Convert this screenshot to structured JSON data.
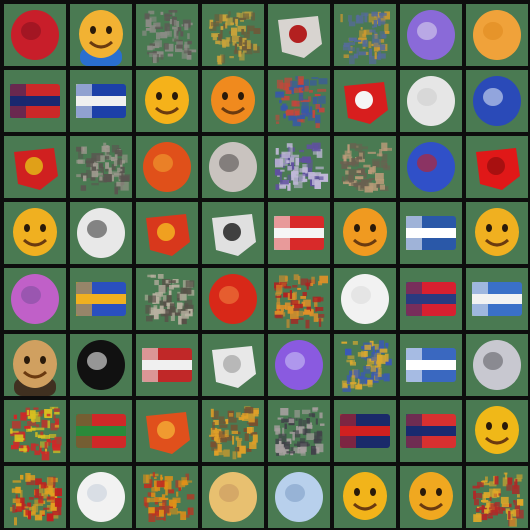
{
  "background_color": "#4a7a52",
  "grid": {
    "rows": 8,
    "cols": 8
  },
  "tiles": [
    {
      "kind": "blob",
      "main": "#c81e2a",
      "accent": "#8a1020"
    },
    {
      "kind": "face-person",
      "main": "#f2b233",
      "accent": "#2a6fd0"
    },
    {
      "kind": "noise",
      "main": "#8c8c86",
      "accent": "#5d5a55"
    },
    {
      "kind": "noise",
      "main": "#c9a33a",
      "accent": "#6d5b3a"
    },
    {
      "kind": "shape",
      "main": "#d8d4d0",
      "accent": "#b32020"
    },
    {
      "kind": "noise",
      "main": "#d09a2e",
      "accent": "#556b9a"
    },
    {
      "kind": "blob",
      "main": "#8a6ad8",
      "accent": "#d8d2ef"
    },
    {
      "kind": "blob",
      "main": "#f0a23a",
      "accent": "#e08a20"
    },
    {
      "kind": "flag",
      "main": "#cc2828",
      "accent": "#1a2870"
    },
    {
      "kind": "flag",
      "main": "#1c40a8",
      "accent": "#f0f0f0"
    },
    {
      "kind": "face",
      "main": "#f5b21a",
      "accent": "#3a2a10"
    },
    {
      "kind": "face",
      "main": "#f08a1e",
      "accent": "#2a6a5a"
    },
    {
      "kind": "noise",
      "main": "#c8453a",
      "accent": "#3858a8"
    },
    {
      "kind": "shape",
      "main": "#d81e1e",
      "accent": "#f5f5f5"
    },
    {
      "kind": "blob",
      "main": "#e6e6e6",
      "accent": "#cfcfcf"
    },
    {
      "kind": "blob",
      "main": "#2a4ab8",
      "accent": "#d8e2f5"
    },
    {
      "kind": "shape",
      "main": "#d02020",
      "accent": "#e0a018"
    },
    {
      "kind": "noise",
      "main": "#a09a90",
      "accent": "#5a5550"
    },
    {
      "kind": "blob",
      "main": "#e0501a",
      "accent": "#f0a030"
    },
    {
      "kind": "blob",
      "main": "#c9c3bf",
      "accent": "#555050"
    },
    {
      "kind": "noise",
      "main": "#c0b8d8",
      "accent": "#6050a0"
    },
    {
      "kind": "noise",
      "main": "#b89a78",
      "accent": "#6a6050"
    },
    {
      "kind": "blob",
      "main": "#3050c8",
      "accent": "#c82020"
    },
    {
      "kind": "shape",
      "main": "#e01818",
      "accent": "#a81010"
    },
    {
      "kind": "face",
      "main": "#f0b020",
      "accent": "#c85a10"
    },
    {
      "kind": "blob",
      "main": "#e8e8e8",
      "accent": "#404040"
    },
    {
      "kind": "shape",
      "main": "#d8381c",
      "accent": "#f0a020"
    },
    {
      "kind": "shape",
      "main": "#e0e0e0",
      "accent": "#404040"
    },
    {
      "kind": "flag",
      "main": "#d82a2a",
      "accent": "#f5f5f5"
    },
    {
      "kind": "face",
      "main": "#f09a20",
      "accent": "#d85010"
    },
    {
      "kind": "flag",
      "main": "#2a58a8",
      "accent": "#ffffff"
    },
    {
      "kind": "face",
      "main": "#f0b020",
      "accent": "#a86020"
    },
    {
      "kind": "blob",
      "main": "#c060c8",
      "accent": "#8050a0"
    },
    {
      "kind": "flag",
      "main": "#2a50c0",
      "accent": "#f0b020"
    },
    {
      "kind": "noise",
      "main": "#b8b0a0",
      "accent": "#585048"
    },
    {
      "kind": "blob",
      "main": "#d82818",
      "accent": "#f08040"
    },
    {
      "kind": "noise",
      "main": "#e09028",
      "accent": "#b02020"
    },
    {
      "kind": "blob",
      "main": "#f2f2f2",
      "accent": "#dcdcdc"
    },
    {
      "kind": "flag",
      "main": "#d82030",
      "accent": "#2a3a80"
    },
    {
      "kind": "flag",
      "main": "#3a70c8",
      "accent": "#f2f2f2"
    },
    {
      "kind": "face-person",
      "main": "#d0a060",
      "accent": "#403020"
    },
    {
      "kind": "blob",
      "main": "#111111",
      "accent": "#f0f0f0"
    },
    {
      "kind": "flag",
      "main": "#c02828",
      "accent": "#f0f0f0"
    },
    {
      "kind": "shape",
      "main": "#e8e8e8",
      "accent": "#b8b8b8"
    },
    {
      "kind": "blob",
      "main": "#8a5ae0",
      "accent": "#c8c0f5"
    },
    {
      "kind": "noise",
      "main": "#3a58b8",
      "accent": "#d8a830"
    },
    {
      "kind": "flag",
      "main": "#3a68c0",
      "accent": "#ffffff"
    },
    {
      "kind": "blob",
      "main": "#c8c8d0",
      "accent": "#606068"
    },
    {
      "kind": "noise",
      "main": "#d02828",
      "accent": "#d8c020"
    },
    {
      "kind": "flag",
      "main": "#d02828",
      "accent": "#2a8a3a"
    },
    {
      "kind": "shape",
      "main": "#e0501c",
      "accent": "#f09a30"
    },
    {
      "kind": "noise",
      "main": "#e0a028",
      "accent": "#7a5030"
    },
    {
      "kind": "noise",
      "main": "#a8a0a0",
      "accent": "#404048"
    },
    {
      "kind": "flag",
      "main": "#1a2a6a",
      "accent": "#d02020"
    },
    {
      "kind": "flag",
      "main": "#d83030",
      "accent": "#1a2a70"
    },
    {
      "kind": "face",
      "main": "#f0b818",
      "accent": "#2a5a48"
    },
    {
      "kind": "noise",
      "main": "#e0a020",
      "accent": "#c02020"
    },
    {
      "kind": "blob",
      "main": "#f2f2f2",
      "accent": "#c8d0dc"
    },
    {
      "kind": "noise",
      "main": "#e09018",
      "accent": "#c03020"
    },
    {
      "kind": "blob",
      "main": "#e8c070",
      "accent": "#c89860"
    },
    {
      "kind": "blob",
      "main": "#b8d0ec",
      "accent": "#80a0c8"
    },
    {
      "kind": "face",
      "main": "#f2b41a",
      "accent": "#3a2a10"
    },
    {
      "kind": "face",
      "main": "#f0a820",
      "accent": "#4a3010"
    },
    {
      "kind": "noise",
      "main": "#e0a828",
      "accent": "#b02828"
    }
  ]
}
